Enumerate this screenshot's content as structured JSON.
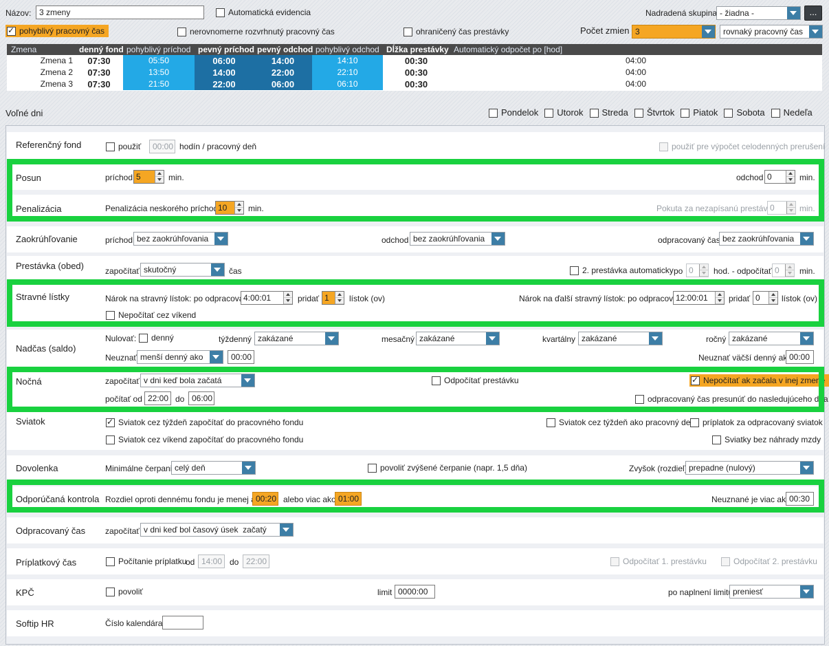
{
  "header": {
    "name_label": "Názov:",
    "name_value": "3 zmeny",
    "auto_evidence": "Automatická evidencia",
    "parent_group_label": "Nadradená skupina:",
    "parent_group_value": "- žiadna -",
    "ellipsis": "...",
    "flexible_time": "pohyblivý pracovný čas",
    "uneven_time": "nerovnomerne rozvrhnutý pracovný čas",
    "limited_break": "ohraničený čas prestávky",
    "shift_count_label": "Počet zmien",
    "shift_count_value": "3",
    "work_time_type": "rovnaký pracovný čas"
  },
  "shift_table": {
    "columns": [
      "Zmena",
      "denný fond",
      "pohyblivý príchod",
      "pevný príchod",
      "pevný odchod",
      "pohyblivý odchod",
      "Dĺžka prestávky",
      "Automatický odpočet po [hod]"
    ],
    "rows": [
      {
        "name": "Zmena 1",
        "fond": "07:30",
        "flex_in": "05:50",
        "fixed_in": "06:00",
        "fixed_out": "14:00",
        "flex_out": "14:10",
        "break": "00:30",
        "auto": "04:00"
      },
      {
        "name": "Zmena 2",
        "fond": "07:30",
        "flex_in": "13:50",
        "fixed_in": "14:00",
        "fixed_out": "22:00",
        "flex_out": "22:10",
        "break": "00:30",
        "auto": "04:00"
      },
      {
        "name": "Zmena 3",
        "fond": "07:30",
        "flex_in": "21:50",
        "fixed_in": "22:00",
        "fixed_out": "06:00",
        "flex_out": "06:10",
        "break": "00:30",
        "auto": "04:00"
      }
    ]
  },
  "free_days": {
    "label": "Voľné dni",
    "days": [
      "Pondelok",
      "Utorok",
      "Streda",
      "Štvrtok",
      "Piatok",
      "Sobota",
      "Nedeľa"
    ]
  },
  "ref_fund": {
    "label": "Referenčný fond",
    "use": "použiť",
    "value": "00:00",
    "unit": "hodín / pracovný deň",
    "use_full": "použiť pre výpočet celodenných prerušení"
  },
  "posun": {
    "label": "Posun",
    "arrival_label": "príchod",
    "arrival_value": "5",
    "min": "min.",
    "departure_label": "odchod",
    "departure_value": "0"
  },
  "penalty": {
    "label": "Penalizácia",
    "late_label": "Penalizácia neskorého príchodu:",
    "late_value": "10",
    "min": "min.",
    "fine_label": "Pokuta za nezapísanú prestávku",
    "fine_value": "0"
  },
  "rounding": {
    "label": "Zaokrúhľovanie",
    "arrival_label": "príchod",
    "arrival_value": "bez zaokrúhľovania",
    "departure_label": "odchod",
    "departure_value": "bez zaokrúhľovania",
    "worked_label": "odpracovaný čas",
    "worked_value": "bez zaokrúhľovania"
  },
  "lunch": {
    "label": "Prestávka (obed)",
    "count_label": "započítať",
    "count_value": "skutočný",
    "time": "čas",
    "second_auto": "2. prestávka automaticky",
    "after": "po",
    "after_value": "0",
    "hod": "hod. - odpočítať",
    "deduct_value": "0",
    "min": "min."
  },
  "meal": {
    "label": "Stravné lístky",
    "claim_label": "Nárok na stravný lístok: po odpracovaní",
    "claim_value": "4:00:01",
    "add_label": "pridať",
    "add_value": "1",
    "tickets": "lístok (ov)",
    "next_label": "Nárok na ďalší stravný lístok: po odpracovaní",
    "next_value": "12:00:01",
    "next_add_value": "0",
    "weekend": "Nepočítať cez víkend"
  },
  "overtime": {
    "label": "Nadčas (saldo)",
    "reset_label": "Nulovať:",
    "daily": "denný",
    "weekly_label": "týždenný",
    "weekly_value": "zakázané",
    "monthly_label": "mesačný",
    "monthly_value": "zakázané",
    "quarterly_label": "kvartálny",
    "quarterly_value": "zakázané",
    "yearly_label": "ročný",
    "yearly_value": "zakázané",
    "unrecognized_label": "Neuznať",
    "unrecognized_value": "menší denný ako",
    "unrecognized_time": "00:00",
    "unrecognized_more_label": "Neuznať väčší denný ako",
    "unrecognized_more_value": "00:00"
  },
  "night": {
    "label": "Nočná",
    "count_label": "započítať",
    "count_value": "v dni keď bola začatá",
    "deduct_break": "Odpočítať prestávku",
    "not_count_other": "Nepočítať ak začala v inej zmene",
    "from_label": "počítať od",
    "from_value": "22:00",
    "to_label": "do",
    "to_value": "06:00",
    "move_next": "odpracovaný čas presunúť do nasledujúceho dňa"
  },
  "holiday": {
    "label": "Sviatok",
    "week_to_fund": "Sviatok cez týždeň započítať do pracovného fondu",
    "week_as_workday": "Sviatok cez týždeň ako pracovný deň",
    "bonus": "príplatok za odpracovaný sviatok",
    "weekend_to_fund": "Sviatok cez víkend započítať do pracovného fondu",
    "no_comp": "Sviatky bez náhrady mzdy"
  },
  "vacation": {
    "label": "Dovolenka",
    "min_label": "Minimálne čerpanie",
    "min_value": "celý deň",
    "increased": "povoliť zvýšené čerpanie (napr. 1,5 dňa)",
    "rest_label": "Zvyšok (rozdiel)",
    "rest_value": "prepadne (nulový)"
  },
  "control": {
    "label": "Odporúčaná kontrola",
    "diff_label": "Rozdiel oproti dennému fondu je menej ako",
    "less_value": "00:20",
    "or_more": "alebo viac ako",
    "more_value": "01:00",
    "unrec_label": "Neuznané je viac ako",
    "unrec_value": "00:30"
  },
  "worked": {
    "label": "Odpracovaný čas",
    "count_label": "započítať",
    "count_value": "v dni keď bol časový úsek  začatý"
  },
  "bonus_time": {
    "label": "Príplatkový čas",
    "counting": "Počítanie príplatku",
    "from_label": "od",
    "from_value": "14:00",
    "to_label": "do",
    "to_value": "22:00",
    "deduct1": "Odpočítať 1. prestávku",
    "deduct2": "Odpočítať 2. prestávku"
  },
  "kpc": {
    "label": "KPČ",
    "allow": "povoliť",
    "limit_label": "limit",
    "limit_value": "0000:00",
    "after_label": "po naplnení limitu",
    "after_value": "preniesť"
  },
  "softip": {
    "label": "Softip HR",
    "cal_label": "Číslo kalendára:",
    "cal_value": ""
  },
  "colors": {
    "accent_orange": "#f5a623",
    "highlight_green": "#19d13f",
    "blue_light": "#23a9e6",
    "blue_dark": "#1d6fa3",
    "select_button": "#3d7ea6"
  }
}
